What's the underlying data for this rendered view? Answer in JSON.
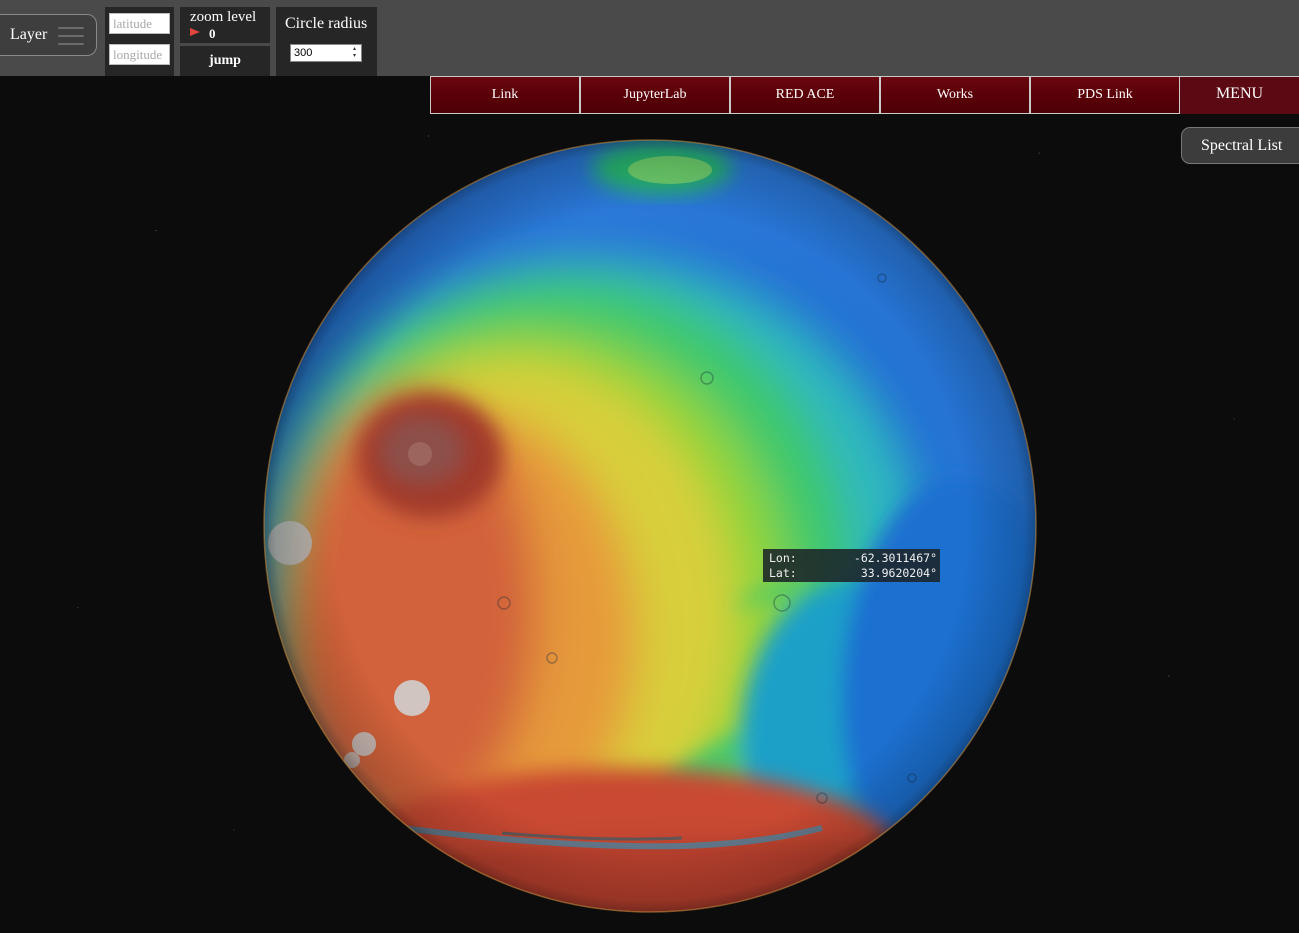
{
  "toolbar": {
    "layer_label": "Layer",
    "latitude_placeholder": "latitude",
    "longitude_placeholder": "longitude",
    "zoom_label": "zoom level",
    "zoom_value": "0",
    "jump_label": "jump",
    "radius_label": "Circle radius",
    "radius_value": "300"
  },
  "nav": {
    "items": [
      {
        "label": "Link"
      },
      {
        "label": "JupyterLab"
      },
      {
        "label": "RED ACE"
      },
      {
        "label": "Works"
      },
      {
        "label": "PDS Link"
      }
    ],
    "menu_label": "MENU",
    "spectral_label": "Spectral List"
  },
  "readout": {
    "lon_label": "Lon:",
    "lon_value": "-62.3011467°",
    "lat_label": "Lat:",
    "lat_value": "33.9620204°"
  },
  "colors": {
    "nav_red": "#5a0008",
    "toolbar_gray": "#4a4a4a",
    "panel_dark": "#262626",
    "zoom_flag": "#e0453c"
  },
  "icons": {
    "layer": "hamburger-icon",
    "zoom": "flag-icon",
    "spin": "spin-arrows-icon"
  }
}
